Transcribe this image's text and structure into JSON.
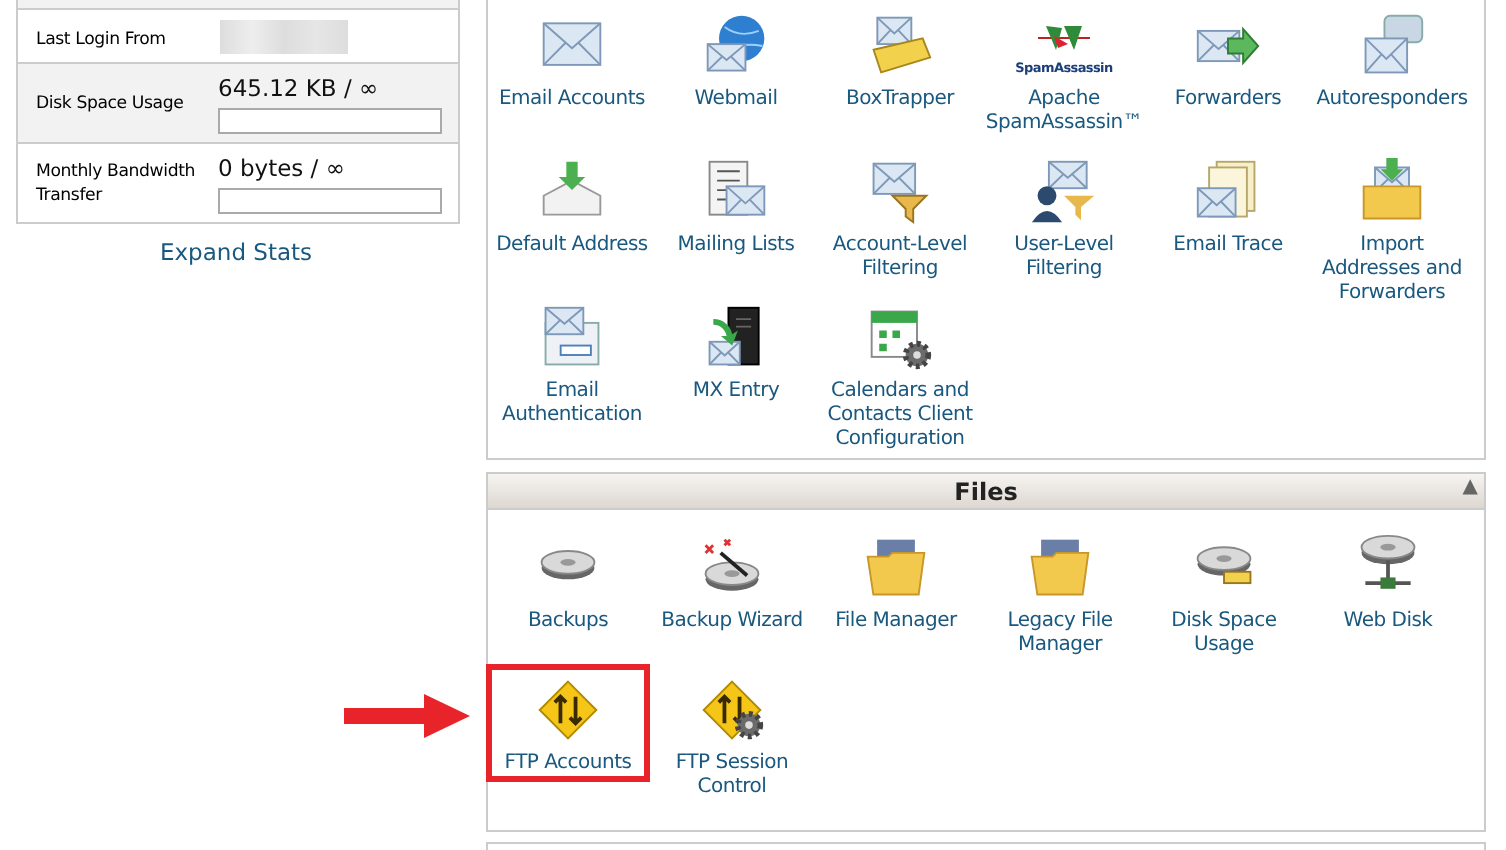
{
  "stats": [
    {
      "kind": "redacted",
      "label": "Last Login From"
    },
    {
      "kind": "usage",
      "label": "Disk Space Usage",
      "value": "645.12 KB / ∞",
      "level": 0
    },
    {
      "kind": "usage",
      "label": "Monthly Bandwidth Transfer",
      "value": "0 bytes / ∞",
      "level": 0
    }
  ],
  "expand_link": "Expand Stats",
  "email_section": {
    "items": [
      {
        "label": "Email Accounts"
      },
      {
        "label": "Webmail"
      },
      {
        "label": "BoxTrapper"
      },
      {
        "label": "Apache SpamAssassin™",
        "logo_text": "SpamAssassin"
      },
      {
        "label": "Forwarders"
      },
      {
        "label": "Autoresponders"
      },
      {
        "label": "Default Address"
      },
      {
        "label": "Mailing Lists"
      },
      {
        "label": "Account-Level Filtering"
      },
      {
        "label": "User-Level Filtering"
      },
      {
        "label": "Email Trace"
      },
      {
        "label": "Import Addresses and Forwarders"
      },
      {
        "label": "Email Authentication"
      },
      {
        "label": "MX Entry"
      },
      {
        "label": "Calendars and Contacts Client Configuration"
      }
    ]
  },
  "files_section": {
    "title": "Files",
    "toggle": "▲",
    "items": [
      {
        "label": "Backups",
        "highlighted": false
      },
      {
        "label": "Backup Wizard",
        "highlighted": false
      },
      {
        "label": "File Manager",
        "highlighted": false
      },
      {
        "label": "Legacy File Manager",
        "highlighted": false
      },
      {
        "label": "Disk Space Usage",
        "highlighted": false
      },
      {
        "label": "Web Disk",
        "highlighted": false
      },
      {
        "label": "FTP Accounts",
        "highlighted": true
      },
      {
        "label": "FTP Session Control",
        "highlighted": false
      }
    ]
  }
}
